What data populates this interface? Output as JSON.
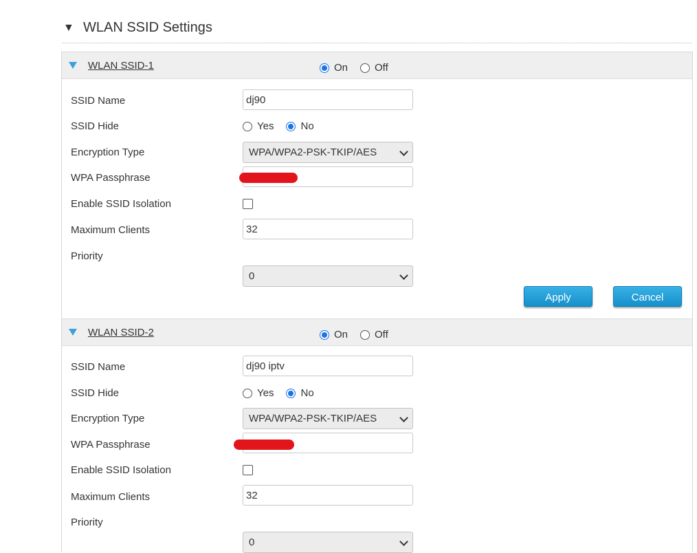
{
  "page": {
    "title": "WLAN SSID Settings"
  },
  "sections": [
    {
      "title": "WLAN SSID-1",
      "on_label": "On",
      "off_label": "Off",
      "state": "On",
      "fields": {
        "ssid_name_label": "SSID Name",
        "ssid_name_value": "dj90",
        "ssid_hide_label": "SSID Hide",
        "yes_label": "Yes",
        "no_label": "No",
        "ssid_hide_value": "No",
        "encryption_label": "Encryption Type",
        "encryption_value": "WPA/WPA2-PSK-TKIP/AES",
        "passphrase_label": "WPA Passphrase",
        "passphrase_value": "[redacted]",
        "isolation_label": "Enable SSID Isolation",
        "isolation_checked": false,
        "max_clients_label": "Maximum Clients",
        "max_clients_value": "32",
        "priority_label": "Priority",
        "priority_value": "0"
      },
      "buttons": {
        "apply": "Apply",
        "cancel": "Cancel"
      }
    },
    {
      "title": "WLAN SSID-2",
      "on_label": "On",
      "off_label": "Off",
      "state": "On",
      "fields": {
        "ssid_name_label": "SSID Name",
        "ssid_name_value": "dj90 iptv",
        "ssid_hide_label": "SSID Hide",
        "yes_label": "Yes",
        "no_label": "No",
        "ssid_hide_value": "No",
        "encryption_label": "Encryption Type",
        "encryption_value": "WPA/WPA2-PSK-TKIP/AES",
        "passphrase_label": "WPA Passphrase",
        "passphrase_value": "[redacted]",
        "isolation_label": "Enable SSID Isolation",
        "isolation_checked": false,
        "max_clients_label": "Maximum Clients",
        "max_clients_value": "32",
        "priority_label": "Priority",
        "priority_value": "0"
      }
    }
  ],
  "colors": {
    "accent": "#1a73e8",
    "button": "#1e98d4",
    "caret": "#3aa3dc",
    "redaction": "#e2141c"
  },
  "icons": {
    "collapse": "triangle-down-icon",
    "select": "chevron-down-icon"
  }
}
